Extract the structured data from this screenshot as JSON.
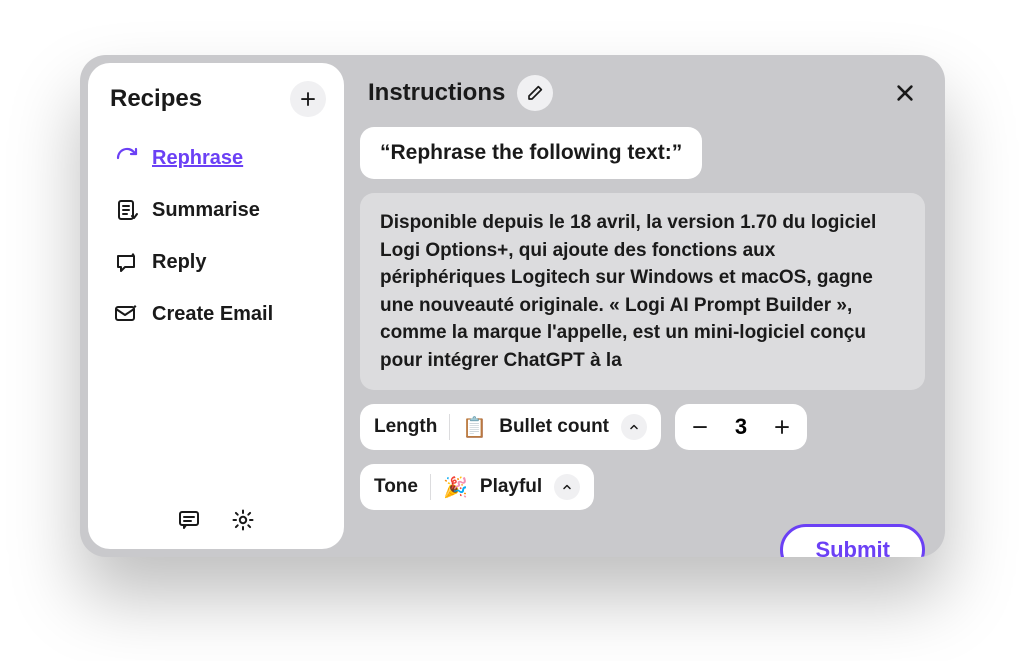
{
  "sidebar": {
    "title": "Recipes",
    "items": [
      {
        "label": "Rephrase",
        "icon": "refresh-icon",
        "active": true
      },
      {
        "label": "Summarise",
        "icon": "summarise-icon",
        "active": false
      },
      {
        "label": "Reply",
        "icon": "reply-icon",
        "active": false
      },
      {
        "label": "Create Email",
        "icon": "create-email-icon",
        "active": false
      }
    ]
  },
  "main": {
    "title": "Instructions",
    "prompt": "“Rephrase the following text:”",
    "body": "Disponible depuis le 18 avril, la version 1.70 du logiciel Logi Options+, qui ajoute des fonctions aux périphériques Logitech sur Windows et macOS, gagne une nouveauté originale. « Logi AI Prompt Builder », comme la marque l'appelle, est un mini-logiciel conçu pour intégrer ChatGPT à la"
  },
  "length": {
    "label": "Length",
    "mode_icon": "📋",
    "mode_label": "Bullet count",
    "value": "3"
  },
  "tone": {
    "label": "Tone",
    "icon": "🎉",
    "value": "Playful"
  },
  "actions": {
    "submit": "Submit"
  }
}
